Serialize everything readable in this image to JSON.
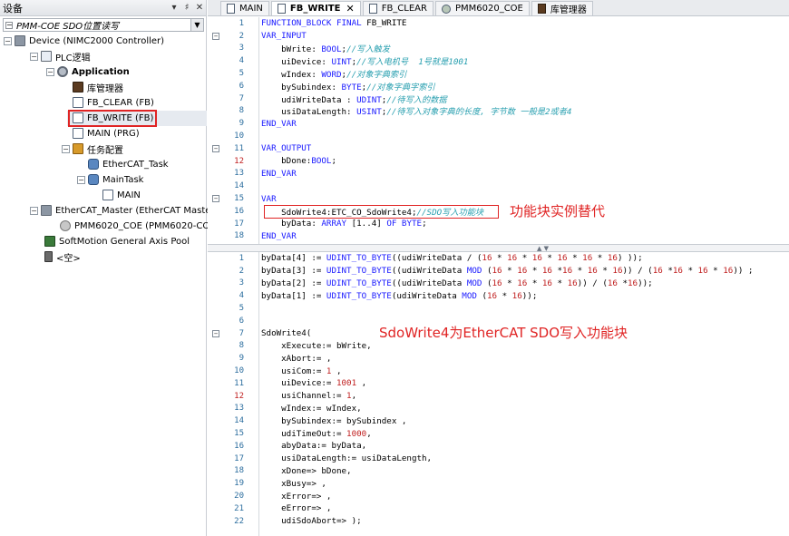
{
  "left_panel": {
    "title": "设备",
    "header_buttons": [
      "▾",
      "♯",
      "✕"
    ],
    "project_combo": "PMM-COE SDO位置读写",
    "tree": [
      {
        "label": "Device (NIMC2000 Controller)",
        "depth": 0
      },
      {
        "label": "PLC逻辑",
        "depth": 1
      },
      {
        "label": "Application",
        "depth": 2
      },
      {
        "label": "库管理器",
        "depth": 3
      },
      {
        "label": "FB_CLEAR (FB)",
        "depth": 3
      },
      {
        "label": "FB_WRITE (FB)",
        "depth": 3
      },
      {
        "label": "MAIN (PRG)",
        "depth": 3
      },
      {
        "label": "任务配置",
        "depth": 3
      },
      {
        "label": "EtherCAT_Task",
        "depth": 4
      },
      {
        "label": "MainTask",
        "depth": 4
      },
      {
        "label": "MAIN",
        "depth": 5
      },
      {
        "label": "EtherCAT_Master (EtherCAT Master)",
        "depth": 1
      },
      {
        "label": "PMM6020_COE (PMM6020-COE)",
        "depth": 2
      },
      {
        "label": "SoftMotion General Axis Pool",
        "depth": 1
      },
      {
        "label": "<空>",
        "depth": 1
      }
    ]
  },
  "tabs": [
    {
      "label": "MAIN",
      "active": false
    },
    {
      "label": "FB_WRITE",
      "active": true,
      "close": "✕"
    },
    {
      "label": "FB_CLEAR",
      "active": false
    },
    {
      "label": "PMM6020_COE",
      "active": false
    },
    {
      "label": "库管理器",
      "active": false
    }
  ],
  "declaration": {
    "lines": [
      {
        "n": "1",
        "code": [
          {
            "t": "kw",
            "s": "FUNCTION_BLOCK FINAL "
          },
          {
            "t": "plain",
            "s": "FB_WRITE"
          }
        ]
      },
      {
        "n": "2",
        "fold": true,
        "code": [
          {
            "t": "kw",
            "s": "VAR_INPUT"
          }
        ]
      },
      {
        "n": "3",
        "code": [
          {
            "t": "plain",
            "s": "    bWrite: "
          },
          {
            "t": "kw",
            "s": "BOOL"
          },
          {
            "t": "plain",
            "s": ";"
          },
          {
            "t": "cm",
            "s": "//写入触发"
          }
        ]
      },
      {
        "n": "4",
        "code": [
          {
            "t": "plain",
            "s": "    uiDevice: "
          },
          {
            "t": "kw",
            "s": "UINT"
          },
          {
            "t": "plain",
            "s": ";"
          },
          {
            "t": "cm",
            "s": "//写入电机号  1号就是1001"
          }
        ]
      },
      {
        "n": "5",
        "code": [
          {
            "t": "plain",
            "s": "    wIndex: "
          },
          {
            "t": "kw",
            "s": "WORD"
          },
          {
            "t": "plain",
            "s": ";"
          },
          {
            "t": "cm",
            "s": "//对象字典索引"
          }
        ]
      },
      {
        "n": "6",
        "code": [
          {
            "t": "plain",
            "s": "    bySubindex: "
          },
          {
            "t": "kw",
            "s": "BYTE"
          },
          {
            "t": "plain",
            "s": ";"
          },
          {
            "t": "cm",
            "s": "//对象字典字索引"
          }
        ]
      },
      {
        "n": "7",
        "code": [
          {
            "t": "plain",
            "s": "    udiWriteData : "
          },
          {
            "t": "kw",
            "s": "UDINT"
          },
          {
            "t": "plain",
            "s": ";"
          },
          {
            "t": "cm",
            "s": "//待写入的数据"
          }
        ]
      },
      {
        "n": "8",
        "code": [
          {
            "t": "plain",
            "s": "    usiDataLength: "
          },
          {
            "t": "kw",
            "s": "USINT"
          },
          {
            "t": "plain",
            "s": ";"
          },
          {
            "t": "cm",
            "s": "//待写入对象字典的长度, 字节数 一般是2或者4"
          }
        ]
      },
      {
        "n": "9",
        "code": [
          {
            "t": "kw",
            "s": "END_VAR"
          }
        ]
      },
      {
        "n": "10",
        "code": []
      },
      {
        "n": "11",
        "fold": true,
        "code": [
          {
            "t": "kw",
            "s": "VAR_OUTPUT"
          }
        ]
      },
      {
        "n": "12",
        "red": true,
        "code": [
          {
            "t": "plain",
            "s": "    bDone:"
          },
          {
            "t": "kw",
            "s": "BOOL"
          },
          {
            "t": "plain",
            "s": ";"
          }
        ]
      },
      {
        "n": "13",
        "code": [
          {
            "t": "kw",
            "s": "END_VAR"
          }
        ]
      },
      {
        "n": "14",
        "code": []
      },
      {
        "n": "15",
        "fold": true,
        "code": [
          {
            "t": "kw",
            "s": "VAR"
          }
        ]
      },
      {
        "n": "16",
        "code": [
          {
            "t": "plain",
            "s": "    SdoWrite4:ETC_CO_SdoWrite4;"
          },
          {
            "t": "cm",
            "s": "//SDO写入功能块"
          }
        ]
      },
      {
        "n": "17",
        "code": [
          {
            "t": "plain",
            "s": "    byData: "
          },
          {
            "t": "kw",
            "s": "ARRAY"
          },
          {
            "t": "plain",
            "s": " [1..4] "
          },
          {
            "t": "kw",
            "s": "OF BYTE"
          },
          {
            "t": "plain",
            "s": ";"
          }
        ]
      },
      {
        "n": "18",
        "code": [
          {
            "t": "kw",
            "s": "END_VAR"
          }
        ]
      }
    ]
  },
  "implementation": {
    "lines": [
      {
        "n": "1",
        "code": [
          {
            "t": "plain",
            "s": "byData[4] := "
          },
          {
            "t": "kw",
            "s": "UDINT_TO_BYTE"
          },
          {
            "t": "plain",
            "s": "((udiWriteData / ("
          },
          {
            "t": "nm",
            "s": "16"
          },
          {
            "t": "plain",
            "s": " * "
          },
          {
            "t": "nm",
            "s": "16"
          },
          {
            "t": "plain",
            "s": " * "
          },
          {
            "t": "nm",
            "s": "16"
          },
          {
            "t": "plain",
            "s": " * "
          },
          {
            "t": "nm",
            "s": "16"
          },
          {
            "t": "plain",
            "s": " * "
          },
          {
            "t": "nm",
            "s": "16"
          },
          {
            "t": "plain",
            "s": " * "
          },
          {
            "t": "nm",
            "s": "16"
          },
          {
            "t": "plain",
            "s": ") ));"
          }
        ]
      },
      {
        "n": "2",
        "code": [
          {
            "t": "plain",
            "s": "byData[3] := "
          },
          {
            "t": "kw",
            "s": "UDINT_TO_BYTE"
          },
          {
            "t": "plain",
            "s": "((udiWriteData "
          },
          {
            "t": "kw",
            "s": "MOD"
          },
          {
            "t": "plain",
            "s": " ("
          },
          {
            "t": "nm",
            "s": "16"
          },
          {
            "t": "plain",
            "s": " * "
          },
          {
            "t": "nm",
            "s": "16"
          },
          {
            "t": "plain",
            "s": " * "
          },
          {
            "t": "nm",
            "s": "16"
          },
          {
            "t": "plain",
            "s": " *"
          },
          {
            "t": "nm",
            "s": "16"
          },
          {
            "t": "plain",
            "s": " * "
          },
          {
            "t": "nm",
            "s": "16"
          },
          {
            "t": "plain",
            "s": " * "
          },
          {
            "t": "nm",
            "s": "16"
          },
          {
            "t": "plain",
            "s": ")) / ("
          },
          {
            "t": "nm",
            "s": "16"
          },
          {
            "t": "plain",
            "s": " *"
          },
          {
            "t": "nm",
            "s": "16"
          },
          {
            "t": "plain",
            "s": " * "
          },
          {
            "t": "nm",
            "s": "16"
          },
          {
            "t": "plain",
            "s": " * "
          },
          {
            "t": "nm",
            "s": "16"
          },
          {
            "t": "plain",
            "s": ")) ;"
          }
        ]
      },
      {
        "n": "3",
        "code": [
          {
            "t": "plain",
            "s": "byData[2] := "
          },
          {
            "t": "kw",
            "s": "UDINT_TO_BYTE"
          },
          {
            "t": "plain",
            "s": "((udiWriteData "
          },
          {
            "t": "kw",
            "s": "MOD"
          },
          {
            "t": "plain",
            "s": " ("
          },
          {
            "t": "nm",
            "s": "16"
          },
          {
            "t": "plain",
            "s": " * "
          },
          {
            "t": "nm",
            "s": "16"
          },
          {
            "t": "plain",
            "s": " * "
          },
          {
            "t": "nm",
            "s": "16"
          },
          {
            "t": "plain",
            "s": " * "
          },
          {
            "t": "nm",
            "s": "16"
          },
          {
            "t": "plain",
            "s": ")) / ("
          },
          {
            "t": "nm",
            "s": "16"
          },
          {
            "t": "plain",
            "s": " *"
          },
          {
            "t": "nm",
            "s": "16"
          },
          {
            "t": "plain",
            "s": "));"
          }
        ]
      },
      {
        "n": "4",
        "code": [
          {
            "t": "plain",
            "s": "byData[1] := "
          },
          {
            "t": "kw",
            "s": "UDINT_TO_BYTE"
          },
          {
            "t": "plain",
            "s": "(udiWriteData "
          },
          {
            "t": "kw",
            "s": "MOD"
          },
          {
            "t": "plain",
            "s": " ("
          },
          {
            "t": "nm",
            "s": "16"
          },
          {
            "t": "plain",
            "s": " * "
          },
          {
            "t": "nm",
            "s": "16"
          },
          {
            "t": "plain",
            "s": "));"
          }
        ]
      },
      {
        "n": "5",
        "code": []
      },
      {
        "n": "6",
        "code": []
      },
      {
        "n": "7",
        "fold": true,
        "code": [
          {
            "t": "plain",
            "s": "SdoWrite4("
          }
        ]
      },
      {
        "n": "8",
        "code": [
          {
            "t": "plain",
            "s": "    xExecute:= bWrite,"
          }
        ]
      },
      {
        "n": "9",
        "code": [
          {
            "t": "plain",
            "s": "    xAbort:= ,"
          }
        ]
      },
      {
        "n": "10",
        "code": [
          {
            "t": "plain",
            "s": "    usiCom:= "
          },
          {
            "t": "nm",
            "s": "1"
          },
          {
            "t": "plain",
            "s": " ,"
          }
        ]
      },
      {
        "n": "11",
        "code": [
          {
            "t": "plain",
            "s": "    uiDevice:= "
          },
          {
            "t": "nm",
            "s": "1001"
          },
          {
            "t": "plain",
            "s": " ,"
          }
        ]
      },
      {
        "n": "12",
        "red": true,
        "code": [
          {
            "t": "plain",
            "s": "    usiChannel:= "
          },
          {
            "t": "nm",
            "s": "1"
          },
          {
            "t": "plain",
            "s": ","
          }
        ]
      },
      {
        "n": "13",
        "code": [
          {
            "t": "plain",
            "s": "    wIndex:= wIndex,"
          }
        ]
      },
      {
        "n": "14",
        "code": [
          {
            "t": "plain",
            "s": "    bySubindex:= bySubindex ,"
          }
        ]
      },
      {
        "n": "15",
        "code": [
          {
            "t": "plain",
            "s": "    udiTimeOut:= "
          },
          {
            "t": "nm",
            "s": "1000"
          },
          {
            "t": "plain",
            "s": ","
          }
        ]
      },
      {
        "n": "16",
        "code": [
          {
            "t": "plain",
            "s": "    abyData:= byData,"
          }
        ]
      },
      {
        "n": "17",
        "code": [
          {
            "t": "plain",
            "s": "    usiDataLength:= usiDataLength,"
          }
        ]
      },
      {
        "n": "18",
        "code": [
          {
            "t": "plain",
            "s": "    xDone=> bDone,"
          }
        ]
      },
      {
        "n": "19",
        "code": [
          {
            "t": "plain",
            "s": "    xBusy=> ,"
          }
        ]
      },
      {
        "n": "20",
        "code": [
          {
            "t": "plain",
            "s": "    xError=> ,"
          }
        ]
      },
      {
        "n": "21",
        "code": [
          {
            "t": "plain",
            "s": "    eError=> ,"
          }
        ]
      },
      {
        "n": "22",
        "code": [
          {
            "t": "plain",
            "s": "    udiSdoAbort=> );"
          }
        ]
      }
    ]
  },
  "annotations": {
    "instance_note": "功能块实例替代",
    "sdo_note": "SdoWrite4为EtherCAT SDO写入功能块"
  },
  "colors": {
    "keyword": "#1a1aff",
    "comment": "#2aa0b0",
    "number": "#c02020",
    "annotation": "#e02424"
  }
}
